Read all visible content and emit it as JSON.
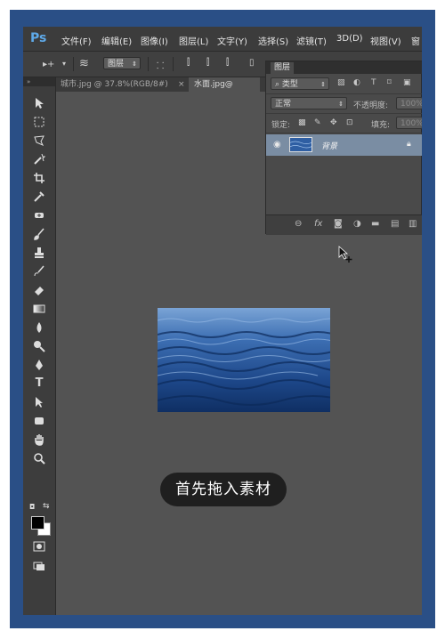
{
  "app": {
    "logo": "Ps"
  },
  "menu": [
    "文件(F)",
    "编辑(E)",
    "图像(I)",
    "图层(L)",
    "文字(Y)",
    "选择(S)",
    "滤镜(T)",
    "3D(D)",
    "视图(V)",
    "窗"
  ],
  "options_bar": {
    "mode_select": "图层",
    "arrow": "▸+"
  },
  "tabs": [
    {
      "label": "城市.jpg @ 37.8%(RGB/8#)",
      "close": "×"
    },
    {
      "label": "水面.jpg@"
    }
  ],
  "toolbar": {
    "collapse": "»"
  },
  "layers_panel": {
    "title": "图层",
    "filter_label": "类型",
    "blend_mode": "正常",
    "opacity_label": "不透明度:",
    "opacity_value": "100%",
    "lock_label": "锁定:",
    "fill_label": "填充:",
    "fill_value": "100%",
    "layer_name": "背景"
  },
  "caption": "首先拖入素材",
  "colors": {
    "frame": "#2a4f86",
    "workspace": "#535353",
    "selected_layer": "#7a8da3"
  }
}
